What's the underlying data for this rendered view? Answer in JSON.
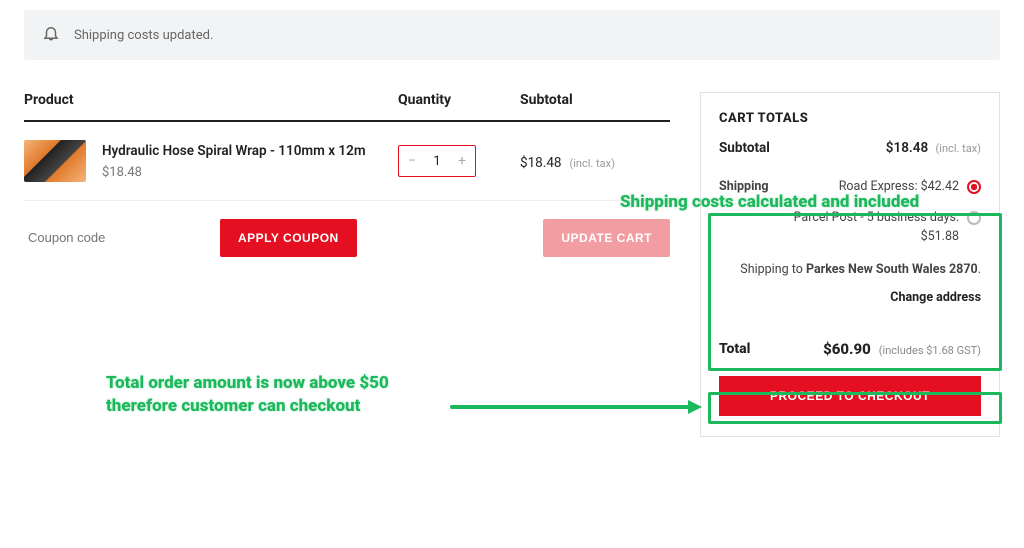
{
  "notice_text": "Shipping costs updated.",
  "headers": {
    "product": "Product",
    "quantity": "Quantity",
    "subtotal": "Subtotal"
  },
  "item": {
    "name": "Hydraulic Hose Spiral Wrap - 110mm x 12m",
    "price": "$18.48",
    "qty": "1",
    "subtotal": "$18.48",
    "tax_note": "(incl. tax)"
  },
  "actions": {
    "coupon_placeholder": "Coupon code",
    "apply_label": "APPLY COUPON",
    "update_label": "UPDATE CART"
  },
  "totals": {
    "title": "CART TOTALS",
    "subtotal_label": "Subtotal",
    "subtotal_value": "$18.48",
    "subtotal_note": "(incl. tax)",
    "shipping_label": "Shipping",
    "ship_opt1": "Road Express: $42.42",
    "ship_opt2": "Parcel Post - 5 business days: $51.88",
    "shipping_to_prefix": "Shipping to ",
    "shipping_to_value": "Parkes New South Wales 2870",
    "change_address": "Change address",
    "total_label": "Total",
    "total_value": "$60.90",
    "total_note": "(includes $1.68 GST)",
    "checkout_label": "PROCEED TO CHECKOUT"
  },
  "annotations": {
    "ship_note": "Shipping costs calculated and included",
    "total_note_line1": "Total order amount is now above $50",
    "total_note_line2": "therefore customer can checkout"
  }
}
